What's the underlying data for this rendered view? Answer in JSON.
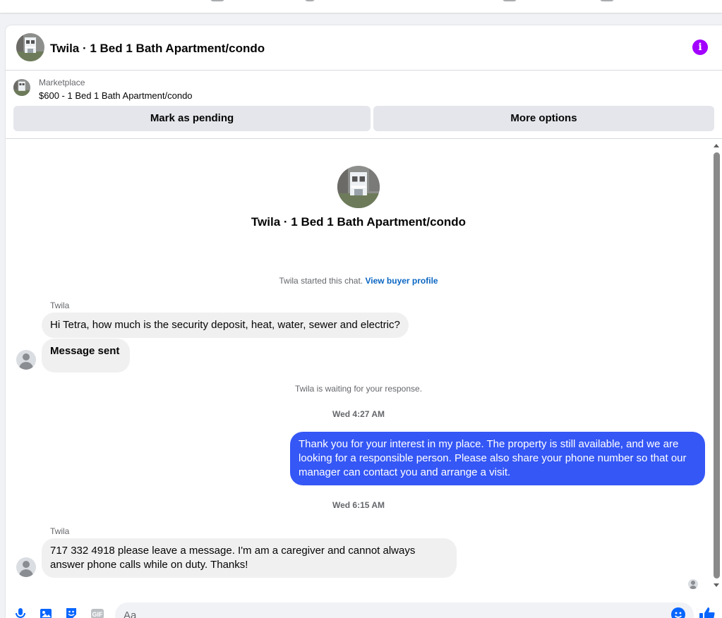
{
  "colors": {
    "accent": "#0866ff",
    "outgoing_bubble": "#3557f5",
    "incoming_bubble": "#f0f0f0",
    "info_icon": "#a200ff",
    "link": "#0a66c2",
    "muted_text": "#65676b"
  },
  "header": {
    "title": "Twila · 1 Bed 1 Bath Apartment/condo",
    "info_icon": "info-icon"
  },
  "listing": {
    "source": "Marketplace",
    "price_title": "$600 - 1 Bed 1 Bath Apartment/condo",
    "mark_pending_label": "Mark as pending",
    "more_options_label": "More options"
  },
  "chat": {
    "title": "Twila · 1 Bed 1 Bath Apartment/condo",
    "started_text": "Twila started this chat.",
    "view_profile_link": "View buyer profile",
    "waiting_text": "Twila is waiting for your response.",
    "messages": [
      {
        "sender": "Twila",
        "text": "Hi Tetra, how much is the security deposit, heat, water, sewer and electric?"
      },
      {
        "text": "Message sent"
      },
      {
        "timestamp": "Wed 4:27 AM",
        "text": "Thank you for your interest in my place. The property is still available, and we are looking for a responsible person. Please also share your phone number so that our manager can contact you and arrange a visit."
      },
      {
        "timestamp": "Wed 6:15 AM",
        "sender": "Twila",
        "text": "717 332 4918 please leave a message. I'm am a caregiver and cannot always answer phone calls while on duty. Thanks!"
      }
    ]
  },
  "composer": {
    "placeholder": "Aa",
    "icons": [
      "microphone-icon",
      "photo-icon",
      "sticker-icon",
      "gif-icon",
      "emoji-icon",
      "like-icon"
    ],
    "gif_label": "GIF"
  }
}
